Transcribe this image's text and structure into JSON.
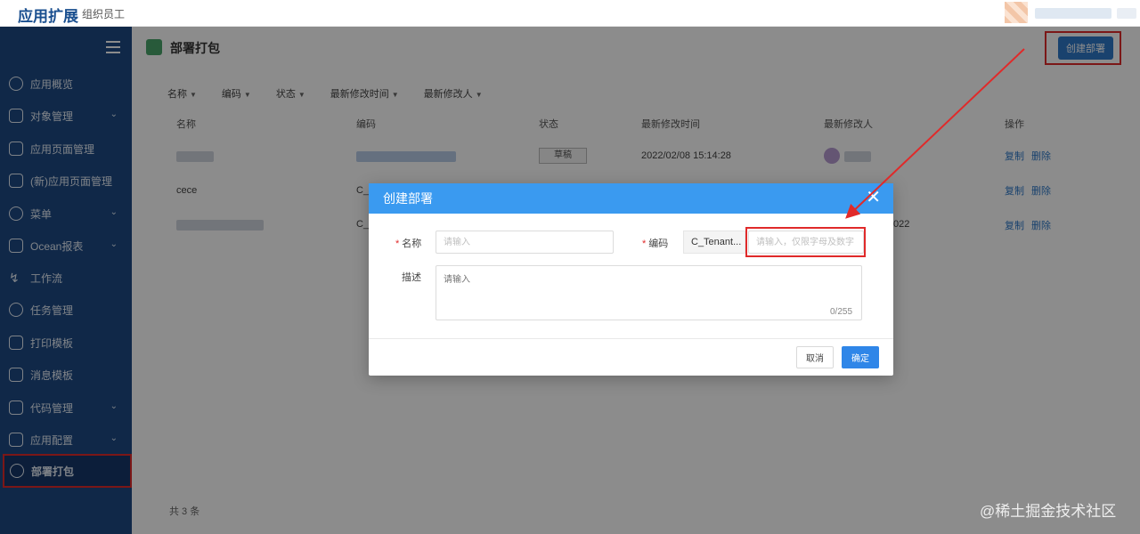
{
  "header": {
    "app_title": "应用扩展",
    "org_name": "组织员工"
  },
  "sidebar": {
    "items": [
      {
        "label": "应用概览",
        "has_chevron": false
      },
      {
        "label": "对象管理",
        "has_chevron": true
      },
      {
        "label": "应用页面管理",
        "has_chevron": false
      },
      {
        "label": "(新)应用页面管理",
        "has_chevron": false
      },
      {
        "label": "菜单",
        "has_chevron": true
      },
      {
        "label": "Ocean报表",
        "has_chevron": true
      },
      {
        "label": "工作流",
        "has_chevron": false
      },
      {
        "label": "任务管理",
        "has_chevron": false
      },
      {
        "label": "打印模板",
        "has_chevron": false
      },
      {
        "label": "消息模板",
        "has_chevron": false
      },
      {
        "label": "代码管理",
        "has_chevron": true
      },
      {
        "label": "应用配置",
        "has_chevron": true
      },
      {
        "label": "部署打包",
        "has_chevron": false,
        "active": true
      }
    ]
  },
  "main": {
    "page_title": "部署打包",
    "create_button": "创建部署",
    "filters": [
      "名称",
      "编码",
      "状态",
      "最新修改时间",
      "最新修改人"
    ],
    "columns": [
      "名称",
      "编码",
      "状态",
      "最新修改时间",
      "最新修改人",
      "操作"
    ],
    "rows": [
      {
        "name": "",
        "code": "",
        "status": "草稿",
        "modified_time": "2022/02/08 15:14:28",
        "modifier": ""
      },
      {
        "name": "cece",
        "code": "C_",
        "status": "",
        "modified_time": "",
        "modifier": ""
      },
      {
        "name": "",
        "code": "C_",
        "status": "",
        "modified_time": "022",
        "modifier": ""
      }
    ],
    "action_copy": "复制",
    "action_delete": "删除",
    "total": "共 3 条"
  },
  "modal": {
    "title": "创建部署",
    "name_label": "名称",
    "name_placeholder": "请输入",
    "code_label": "编码",
    "code_prefix": "C_Tenant...",
    "code_placeholder": "请输入，仅限字母及数字",
    "desc_label": "描述",
    "desc_placeholder": "请输入",
    "desc_counter": "0/255",
    "cancel": "取消",
    "ok": "确定"
  },
  "watermark": "@稀土掘金技术社区",
  "colors": {
    "sidebar": "#1e4a84",
    "primary": "#2f79c8",
    "modal_header": "#3a9af0",
    "highlight": "#e02a2a"
  }
}
